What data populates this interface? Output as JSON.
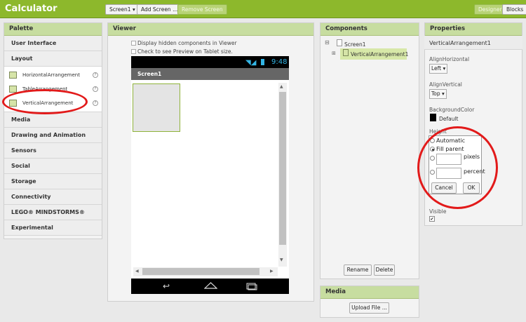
{
  "app": {
    "title": "Calculator"
  },
  "toolbar": {
    "screen_select": "Screen1 ▾",
    "add_screen": "Add Screen ...",
    "remove_screen": "Remove Screen",
    "designer": "Designer",
    "blocks": "Blocks"
  },
  "palette": {
    "title": "Palette",
    "user_interface": "User Interface",
    "layout": "Layout",
    "layout_items": [
      {
        "label": "HorizontalArrangement",
        "help": "?"
      },
      {
        "label": "TableArrangement",
        "help": "?"
      },
      {
        "label": "VerticalArrangement",
        "help": "?"
      }
    ],
    "categories": [
      "Media",
      "Drawing and Animation",
      "Sensors",
      "Social",
      "Storage",
      "Connectivity",
      "LEGO® MINDSTORMS®",
      "Experimental"
    ]
  },
  "viewer": {
    "title": "Viewer",
    "display_hidden": "Display hidden components in Viewer",
    "tablet_preview": "Check to see Preview on Tablet size.",
    "phone_time": "9:48",
    "screen_title": "Screen1"
  },
  "components": {
    "title": "Components",
    "screen": "Screen1",
    "child": "VerticalArrangement1",
    "rename": "Rename",
    "delete": "Delete",
    "expand_glyph": "⊟",
    "child_expand_glyph": "⊞"
  },
  "media": {
    "title": "Media",
    "upload": "Upload File ..."
  },
  "properties": {
    "title": "Properties",
    "component": "VerticalArrangement1",
    "align_horizontal_label": "AlignHorizontal",
    "align_horizontal_value": "Left ▾",
    "align_vertical_label": "AlignVertical",
    "align_vertical_value": "Top ▾",
    "background_color_label": "BackgroundColor",
    "background_color_value": "Default",
    "background_color_swatch": "#000000",
    "height_label": "Height",
    "height_options": {
      "automatic": "Automatic",
      "fill_parent": "Fill parent",
      "pixels": "pixels",
      "percent": "percent"
    },
    "height_selected": "Fill parent",
    "cancel": "Cancel",
    "ok": "OK",
    "visible_label": "Visible",
    "visible_check": "✔"
  },
  "colors": {
    "topbar": "#8db82c",
    "panel_header": "#c7dda0",
    "annotation": "#e21a1a",
    "selected": "#d7e8a8"
  }
}
